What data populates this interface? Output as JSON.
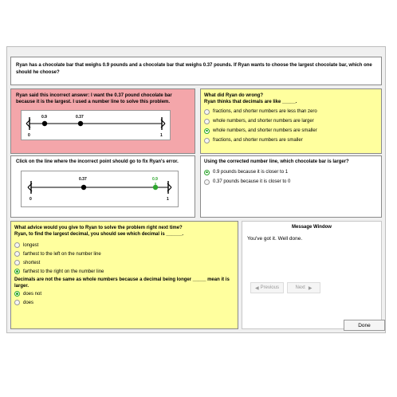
{
  "question": "Ryan has a chocolate bar that weighs 0.9 pounds and a chocolate bar that weighs 0.37 pounds. If Ryan wants to choose the largest chocolate bar, which one should he choose?",
  "incorrect": {
    "text": "Ryan said this incorrect answer: I want the 0.37 pound chocolate bar because it is the largest. I used a number line to solve this problem.",
    "numberline": {
      "min_label": "0",
      "max_label": "1",
      "points": [
        {
          "label": "0.9"
        },
        {
          "label": "0.37"
        }
      ]
    }
  },
  "wrong_q": {
    "title": "What did Ryan do wrong?",
    "prompt": "Ryan thinks that decimals are like _____.",
    "options": [
      "fractions, and shorter numbers are less than zero",
      "whole numbers, and shorter numbers are larger",
      "whole numbers, and shorter numbers are smaller",
      "fractions, and shorter numbers are smaller"
    ],
    "selected_index": 2
  },
  "fix": {
    "title": "Click on the line where the incorrect point should go to fix Ryan's error.",
    "numberline": {
      "min_label": "0",
      "max_label": "1",
      "points": [
        {
          "label": "0.37"
        },
        {
          "label": "0.9"
        }
      ]
    }
  },
  "corrected": {
    "title": "Using the corrected number line, which chocolate bar is larger?",
    "options": [
      "0.9 pounds because it is closer to 1",
      "0.37 pounds because it is closer to 0"
    ],
    "selected_index": 0
  },
  "advice": {
    "title": "What advice would you give to Ryan to solve the problem right next time?",
    "prompt": "Ryan, to find the largest decimal, you should see which decimal is ______.",
    "options": [
      "longest",
      "farthest to the left on the number line",
      "shortest",
      "farthest to the right on the number line"
    ],
    "selected_index": 3,
    "prompt2": "Decimals are not the same as whole numbers because a decimal being longer _____ mean it is larger.",
    "options2": [
      "does not",
      "does"
    ],
    "selected_index2": 0
  },
  "message": {
    "title": "Message Window",
    "text": "You've got it. Well done.",
    "prev": "Previous",
    "next": "Next"
  },
  "done_label": "Done",
  "colors": {
    "pink": "#f4a6aa",
    "yellow": "#ffff9e",
    "green": "#2ea62e"
  }
}
